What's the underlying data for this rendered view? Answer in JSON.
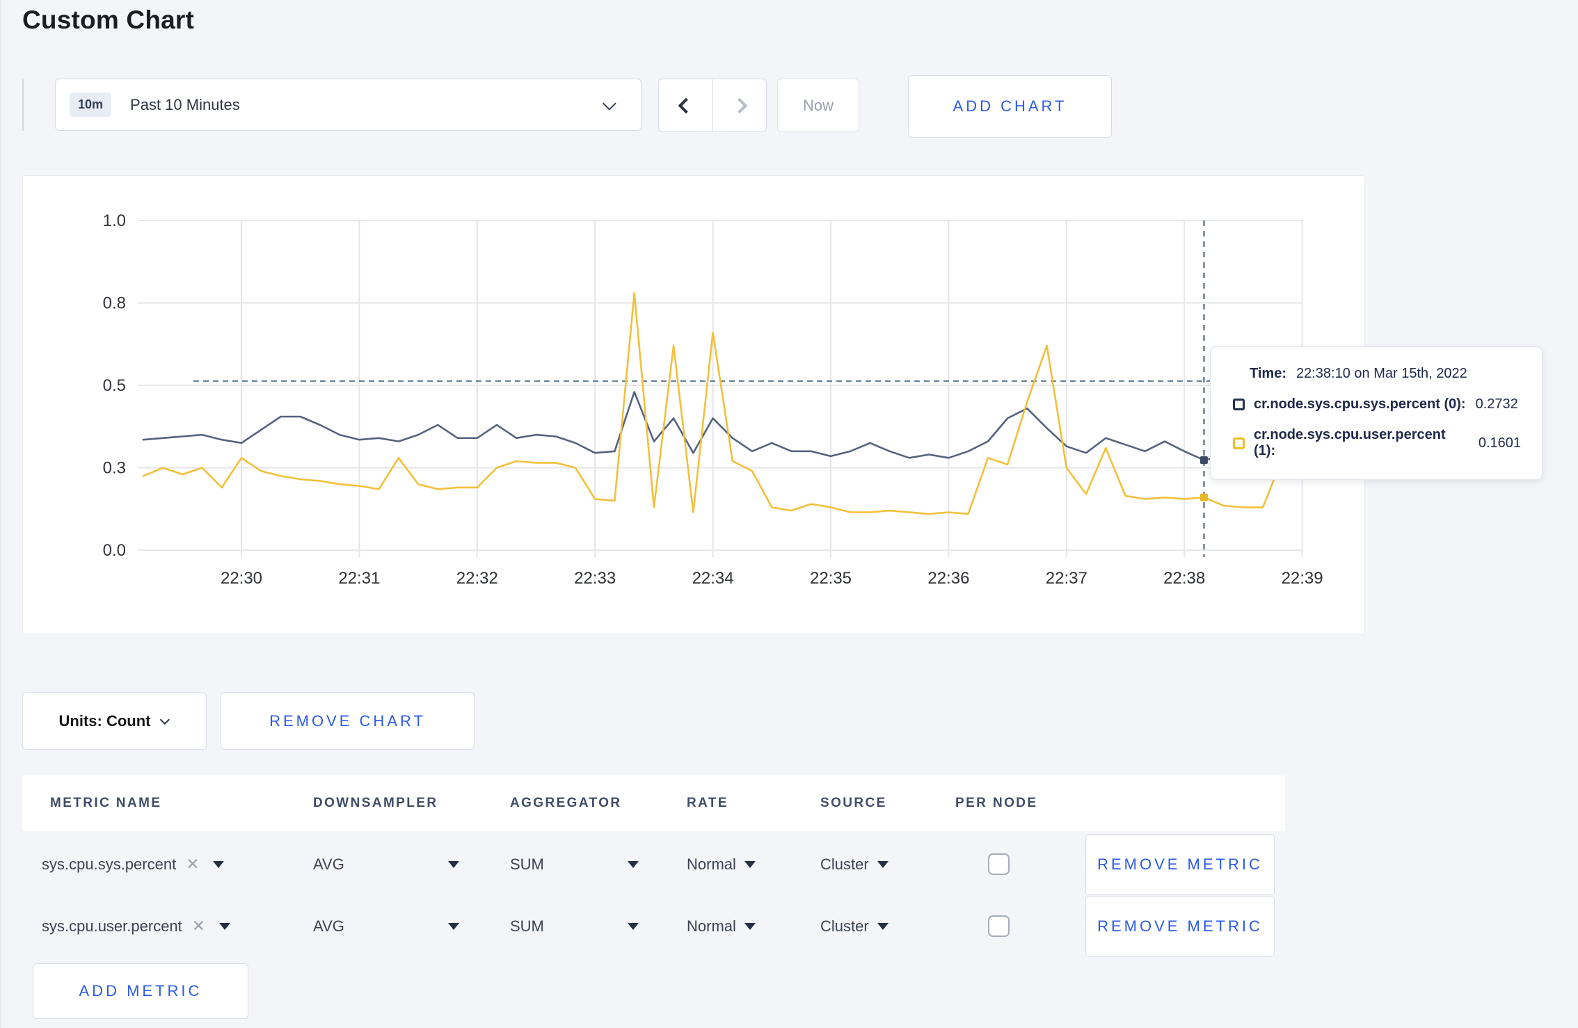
{
  "page": {
    "title": "Custom Chart"
  },
  "toolbar": {
    "time_badge": "10m",
    "time_label": "Past 10 Minutes",
    "now_label": "Now",
    "add_chart_label": "ADD CHART"
  },
  "chart_data": {
    "type": "line",
    "title": "",
    "xlabel": "",
    "ylabel": "",
    "x_axis": {
      "tick_labels": [
        "22:30",
        "22:31",
        "22:32",
        "22:33",
        "22:34",
        "22:35",
        "22:36",
        "22:37",
        "22:38",
        "22:39"
      ],
      "start_time": "22:29:10",
      "interval_seconds": 10
    },
    "y_axis": {
      "tick_labels": [
        "0.0",
        "0.3",
        "0.5",
        "0.8",
        "1.0"
      ],
      "tick_values": [
        0,
        0.25,
        0.5,
        0.75,
        1
      ],
      "range": [
        0,
        1
      ]
    },
    "grid": true,
    "hover_guide_value": 0.513,
    "crosshair": {
      "index": 54,
      "time": "22:38:10"
    },
    "series": [
      {
        "name": "cr.node.sys.cpu.sys.percent (0)",
        "color": "#556280",
        "values": [
          0.335,
          0.34,
          0.345,
          0.35,
          0.335,
          0.325,
          0.365,
          0.405,
          0.405,
          0.38,
          0.35,
          0.335,
          0.34,
          0.33,
          0.35,
          0.38,
          0.34,
          0.34,
          0.38,
          0.34,
          0.35,
          0.345,
          0.325,
          0.295,
          0.3,
          0.48,
          0.33,
          0.4,
          0.295,
          0.4,
          0.34,
          0.3,
          0.325,
          0.3,
          0.3,
          0.285,
          0.3,
          0.325,
          0.3,
          0.28,
          0.29,
          0.28,
          0.3,
          0.33,
          0.4,
          0.43,
          0.37,
          0.315,
          0.295,
          0.34,
          0.32,
          0.3,
          0.33,
          0.3,
          0.2732,
          0.285,
          0.275,
          0.28,
          0.3,
          0.29
        ]
      },
      {
        "name": "cr.node.sys.cpu.user.percent (1)",
        "color": "#f3c03a",
        "values": [
          0.225,
          0.25,
          0.23,
          0.25,
          0.19,
          0.28,
          0.24,
          0.225,
          0.215,
          0.21,
          0.2,
          0.195,
          0.185,
          0.28,
          0.2,
          0.185,
          0.19,
          0.19,
          0.25,
          0.27,
          0.265,
          0.265,
          0.25,
          0.155,
          0.15,
          0.78,
          0.13,
          0.62,
          0.115,
          0.66,
          0.27,
          0.24,
          0.13,
          0.12,
          0.14,
          0.13,
          0.115,
          0.115,
          0.12,
          0.115,
          0.11,
          0.115,
          0.11,
          0.28,
          0.26,
          0.45,
          0.62,
          0.25,
          0.17,
          0.31,
          0.165,
          0.155,
          0.16,
          0.155,
          0.1601,
          0.135,
          0.13,
          0.13,
          0.28,
          0.22
        ]
      }
    ],
    "legend_position": "tooltip"
  },
  "tooltip": {
    "time_label": "Time:",
    "time_value": "22:38:10 on Mar 15th, 2022",
    "series": [
      {
        "name": "cr.node.sys.cpu.sys.percent (0):",
        "value": "0.2732",
        "swatch_color": "#25314e"
      },
      {
        "name": "cr.node.sys.cpu.user.percent (1):",
        "value": "0.1601",
        "swatch_color": "#f2bd2b"
      }
    ]
  },
  "chart_footer": {
    "units_label": "Units: Count",
    "remove_chart_label": "REMOVE CHART"
  },
  "metrics_table": {
    "headers": [
      "METRIC NAME",
      "DOWNSAMPLER",
      "AGGREGATOR",
      "RATE",
      "SOURCE",
      "PER NODE"
    ],
    "rows": [
      {
        "name": "sys.cpu.sys.percent",
        "downsampler": "AVG",
        "aggregator": "SUM",
        "rate": "Normal",
        "source": "Cluster",
        "per_node": false,
        "remove_label": "REMOVE METRIC"
      },
      {
        "name": "sys.cpu.user.percent",
        "downsampler": "AVG",
        "aggregator": "SUM",
        "rate": "Normal",
        "source": "Cluster",
        "per_node": false,
        "remove_label": "REMOVE METRIC"
      }
    ],
    "add_metric_label": "ADD METRIC"
  }
}
